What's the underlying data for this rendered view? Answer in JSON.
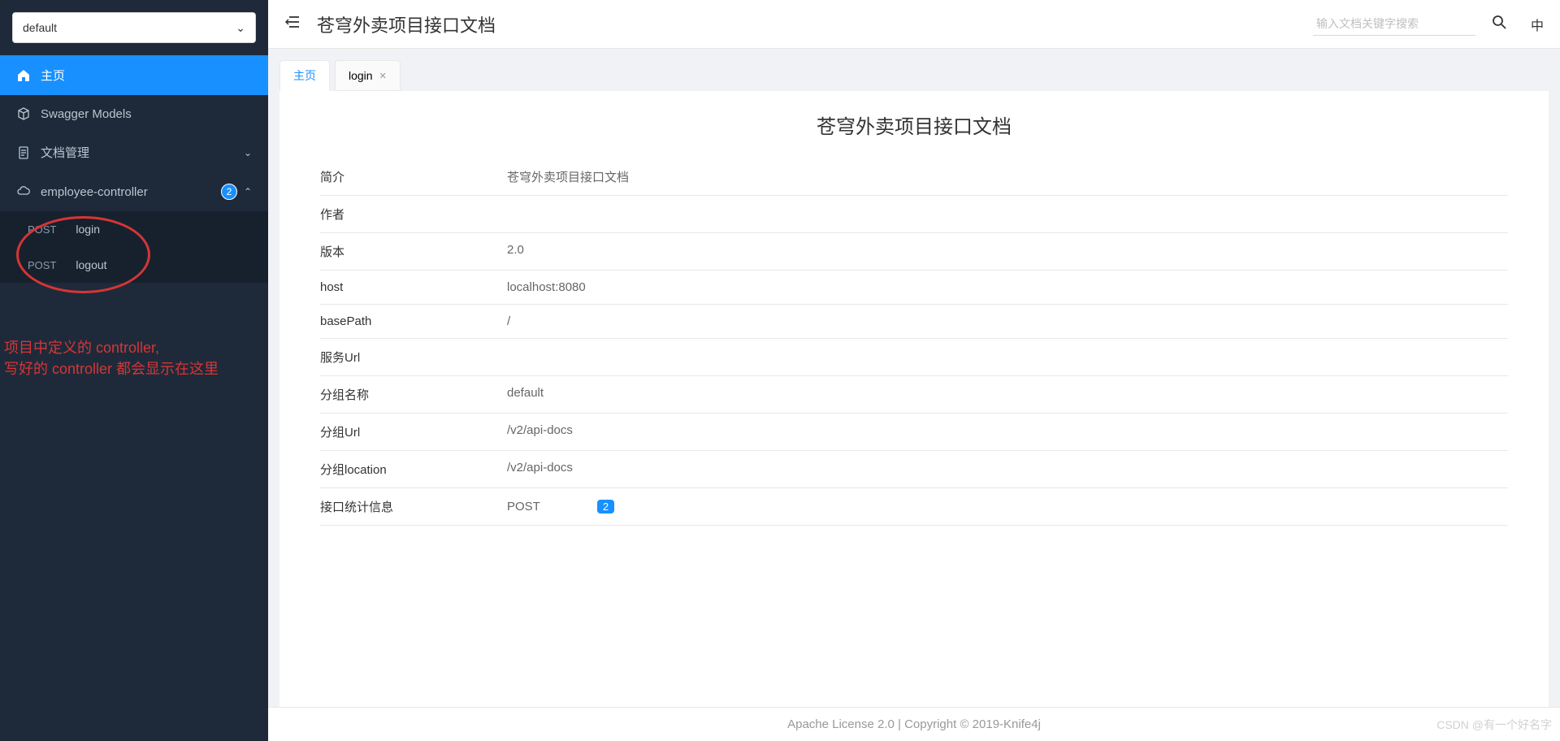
{
  "sidebar": {
    "dropdown_value": "default",
    "items": [
      {
        "label": "主页"
      },
      {
        "label": "Swagger Models"
      },
      {
        "label": "文档管理"
      },
      {
        "label": "employee-controller",
        "count": "2"
      }
    ],
    "sub_items": [
      {
        "method": "POST",
        "name": "login"
      },
      {
        "method": "POST",
        "name": "logout"
      }
    ]
  },
  "annotation": {
    "line1": "项目中定义的 controller,",
    "line2": "写好的 controller 都会显示在这里"
  },
  "header": {
    "title": "苍穹外卖项目接口文档",
    "search_placeholder": "输入文档关键字搜索",
    "lang": "中"
  },
  "tabs": [
    {
      "label": "主页"
    },
    {
      "label": "login"
    }
  ],
  "doc": {
    "title": "苍穹外卖项目接口文档",
    "rows": [
      {
        "label": "简介",
        "value": "苍穹外卖项目接口文档"
      },
      {
        "label": "作者",
        "value": ""
      },
      {
        "label": "版本",
        "value": "2.0"
      },
      {
        "label": "host",
        "value": "localhost:8080"
      },
      {
        "label": "basePath",
        "value": "/"
      },
      {
        "label": "服务Url",
        "value": ""
      },
      {
        "label": "分组名称",
        "value": "default"
      },
      {
        "label": "分组Url",
        "value": "/v2/api-docs"
      },
      {
        "label": "分组location",
        "value": "/v2/api-docs"
      }
    ],
    "stat_label": "接口统计信息",
    "stat_method": "POST",
    "stat_count": "2"
  },
  "footer": "Apache License 2.0 | Copyright © 2019-Knife4j",
  "watermark": "CSDN @有一个好名字"
}
